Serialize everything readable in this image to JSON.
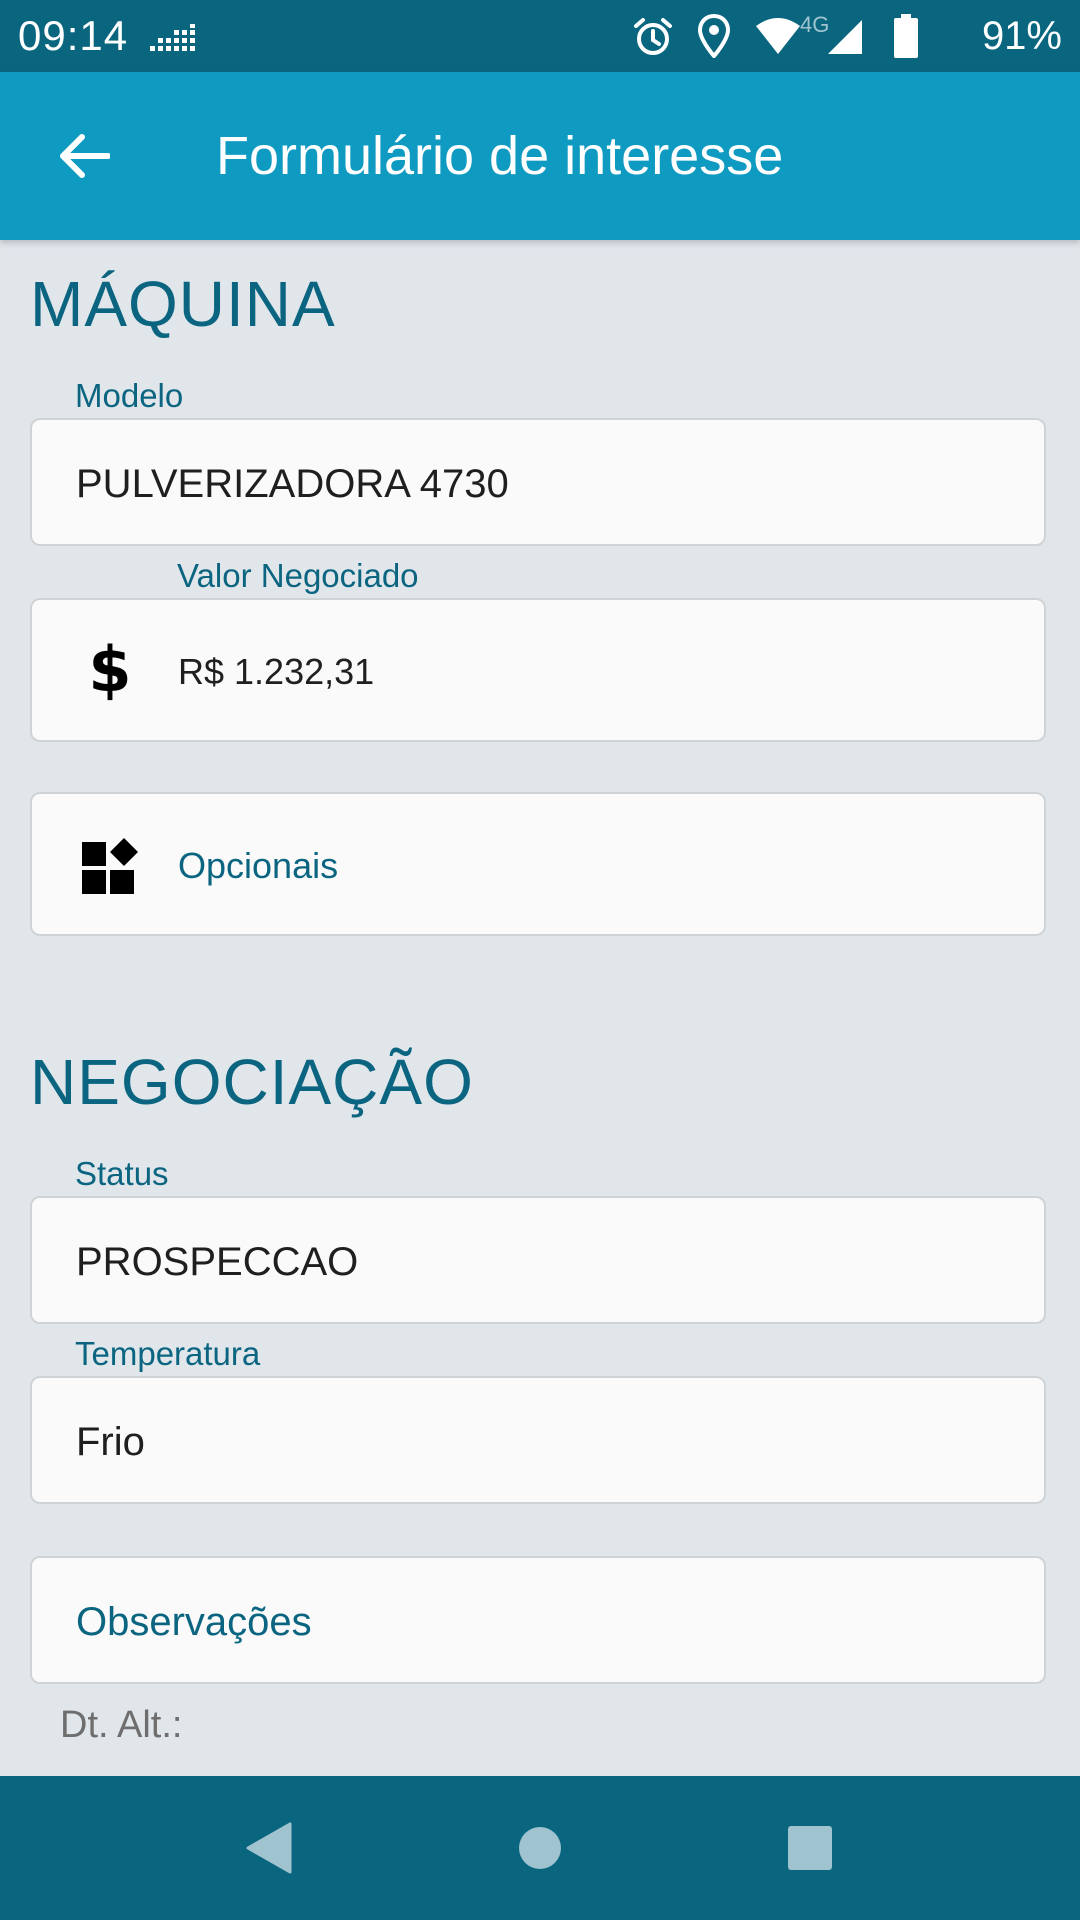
{
  "status_bar": {
    "time": "09:14",
    "network": "4G",
    "battery": "91%"
  },
  "app_bar": {
    "title": "Formulário de interesse",
    "back_icon": "arrow-left-icon"
  },
  "machine_section": {
    "title": "MÁQUINA",
    "model": {
      "label": "Modelo",
      "value": "PULVERIZADORA 4730"
    },
    "negotiated_value": {
      "label": "Valor Negociado",
      "value": "R$ 1.232,31",
      "icon": "dollar-icon"
    },
    "optionals": {
      "label": "Opcionais",
      "icon": "widgets-icon"
    }
  },
  "negotiation_section": {
    "title": "NEGOCIAÇÃO",
    "status": {
      "label": "Status",
      "value": "PROSPECCAO"
    },
    "temperature": {
      "label": "Temperatura",
      "value": "Frio"
    },
    "notes": {
      "label": "Observações"
    }
  },
  "footer": {
    "date_changed_label": "Dt. Alt.:"
  },
  "colors": {
    "status_bar": "#0a667f",
    "app_bar": "#0e9ac1",
    "accent_text": "#0b6581",
    "background": "#e1e6eb"
  }
}
